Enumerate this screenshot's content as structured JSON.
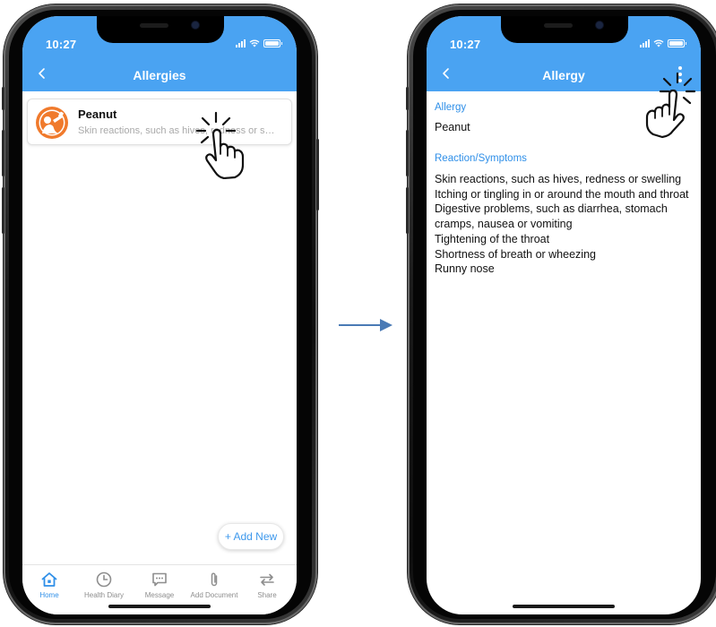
{
  "colors": {
    "header": "#4aa3f2",
    "accent": "#2f8fe8",
    "arrow": "#4a7ab5"
  },
  "left_screen": {
    "status_time": "10:27",
    "title": "Allergies",
    "allergy_item": {
      "name": "Peanut",
      "description": "Skin reactions, such as hives, redness or swelling",
      "icon": "peanut-avatar-icon"
    },
    "add_new_label": "+ Add New",
    "tabs": [
      {
        "label": "Home",
        "icon": "home-icon",
        "active": true
      },
      {
        "label": "Health Diary",
        "icon": "clock-icon",
        "active": false
      },
      {
        "label": "Message",
        "icon": "message-icon",
        "active": false
      },
      {
        "label": "Add Document",
        "icon": "paperclip-icon",
        "active": false
      },
      {
        "label": "Share",
        "icon": "share-icon",
        "active": false
      }
    ]
  },
  "right_screen": {
    "status_time": "10:27",
    "title": "Allergy",
    "allergy_label": "Allergy",
    "allergy_value": "Peanut",
    "reaction_label": "Reaction/Symptoms",
    "symptoms": [
      "Skin reactions, such as hives, redness or swelling",
      "Itching or tingling in or around the mouth and throat",
      "Digestive problems, such as diarrhea, stomach cramps, nausea or vomiting",
      "Tightening of the throat",
      "Shortness of breath or wheezing",
      "Runny nose"
    ]
  }
}
